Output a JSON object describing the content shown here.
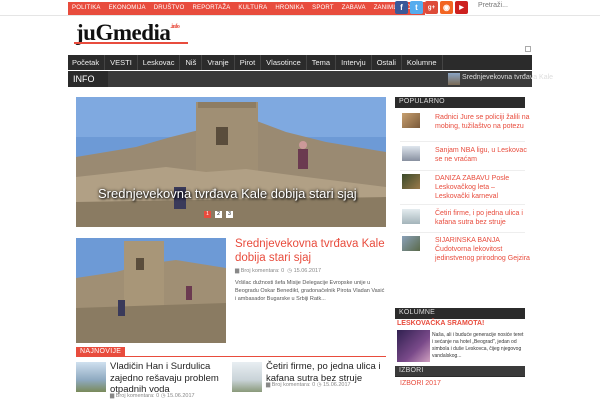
{
  "topnav": [
    "POLITIKA",
    "EKONOMIJA",
    "DRUŠTVO",
    "REPORTAŽA",
    "KULTURA",
    "HRONIKA",
    "SPORT",
    "ZABAVA",
    "ZANIMLJIVOSTI"
  ],
  "social": [
    {
      "icon": "facebook-icon",
      "glyph": "f",
      "color": "#3b5998"
    },
    {
      "icon": "twitter-icon",
      "glyph": "t",
      "color": "#55acee"
    },
    {
      "icon": "google-plus-icon",
      "glyph": "g+",
      "color": "#dd4b39"
    },
    {
      "icon": "rss-icon",
      "glyph": "◉",
      "color": "#f26522"
    },
    {
      "icon": "youtube-icon",
      "glyph": "▶",
      "color": "#cd201f"
    }
  ],
  "search": {
    "placeholder": "Pretraži..."
  },
  "logo": {
    "text": "juGmedia",
    "suffix": ".info"
  },
  "mainnav": [
    "Početak",
    "VESTI",
    "Leskovac",
    "Niš",
    "Vranje",
    "Pirot",
    "Vlasotince",
    "Tema",
    "Intervju",
    "Ostali",
    "Kolumne"
  ],
  "ticker": {
    "label": "INFO",
    "text": "Srednjevekovna tvrđava Kale"
  },
  "hero": {
    "title": "Srednjevekovna tvrđava Kale dobija stari sjaj",
    "slides": [
      "1",
      "2",
      "3"
    ]
  },
  "article": {
    "title": "Srednjevekovna tvrđava Kale dobija stari sjaj",
    "comments": "Broj komentara: 0",
    "date": "15.06.2017",
    "excerpt": "Vršilac dužnosti šefa Misije Delegacije Evropske unije u Beogradu Oskar Benedikt, gradonačelnik Pirota Vladan Vasić i ambasador Bugarske u Srbiji Ratk..."
  },
  "najnovije": {
    "label": "NAJNOVIJE",
    "items": [
      {
        "title": "Vladičin Han i Surdulica zajedno rešavaju problem otpadnih voda",
        "comments": "Broj komentara: 0",
        "date": "15.06.2017"
      },
      {
        "title": "Četiri firme, po jedna ulica i kafana sutra bez struje",
        "comments": "Broj komentara: 0",
        "date": "15.06.2017"
      }
    ]
  },
  "popularno": {
    "label": "POPULARNO",
    "items": [
      {
        "title": "Radnici Jure se policiji žalili na mobing, tužilaštvo na potezu"
      },
      {
        "title": "Sanjam NBA ligu, u Leskovac se ne vraćam"
      },
      {
        "title": "DANIZA ZABAVU Posle Leskovačkog leta – Leskovački karneval"
      },
      {
        "title": "Četiri firme, i po jedna ulica i kafana sutra bez struje"
      },
      {
        "title": "SIJARINSKA BANJA Čudotvorna lekovitost jedinstvenog prirodnog Gejzira"
      }
    ]
  },
  "kolumne": {
    "label": "KOLUMNE",
    "title": "LESKOVAČKA SRAMOTA!",
    "text": "Naša, ali i buduće generacije nosiće teret i sećanje na hotel „Beograd\", jedan od simbola i duše Leskovca, čijeg njegovog vandalskog..."
  },
  "izbori": {
    "label": "IZBORI",
    "item": "IZBORI 2017"
  },
  "colors": {
    "accent": "#e84c3d",
    "nav": "#2b2b2b"
  }
}
